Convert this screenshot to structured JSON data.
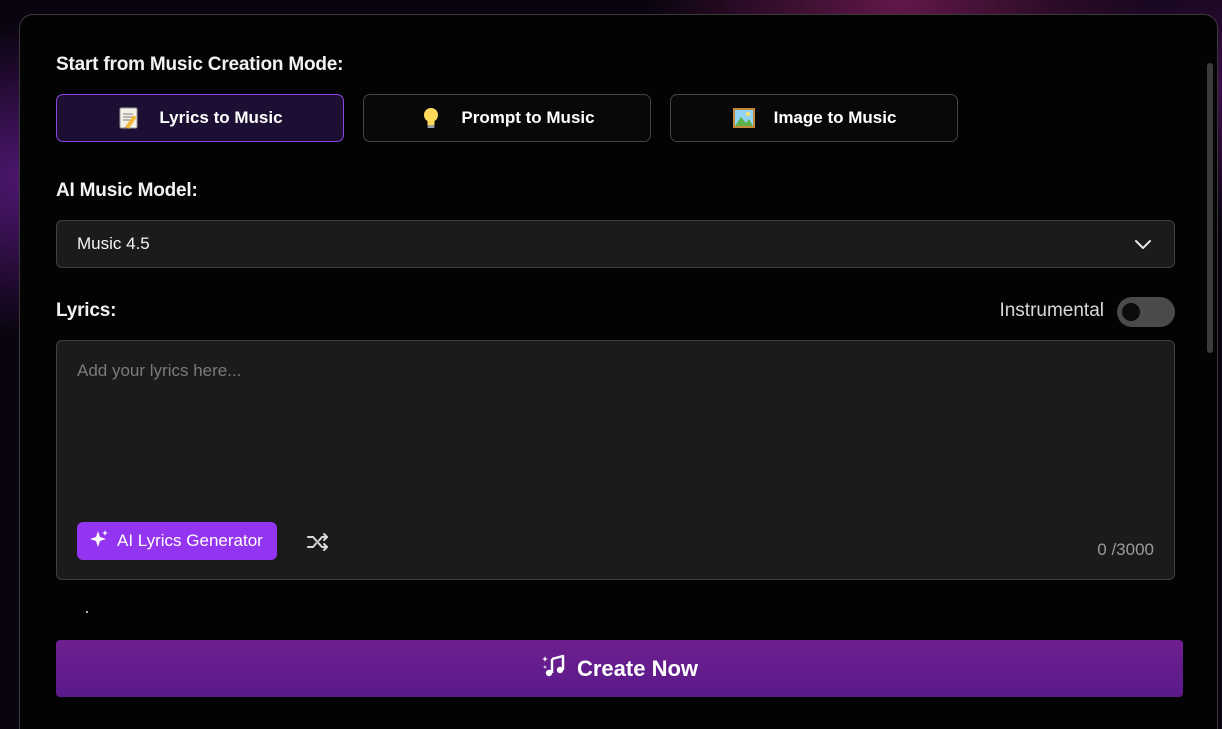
{
  "mode_section": {
    "label": "Start from Music Creation Mode:",
    "modes": [
      {
        "label": "Lyrics to Music",
        "icon": "memo-icon",
        "active": true
      },
      {
        "label": "Prompt to Music",
        "icon": "lightbulb-icon",
        "active": false
      },
      {
        "label": "Image to Music",
        "icon": "framed-picture-icon",
        "active": false
      }
    ]
  },
  "model_section": {
    "label": "AI Music Model:",
    "selected": "Music 4.5"
  },
  "lyrics_section": {
    "label": "Lyrics:",
    "instrumental_label": "Instrumental",
    "instrumental_on": false,
    "placeholder": "Add your lyrics here...",
    "value": "",
    "ai_button_label": "AI Lyrics Generator",
    "counter": "0 /3000"
  },
  "create_button": {
    "label": "Create Now"
  },
  "colors": {
    "accent": "#9334f0",
    "create_button": "#6a1f8e",
    "active_border": "#8a45e0"
  }
}
